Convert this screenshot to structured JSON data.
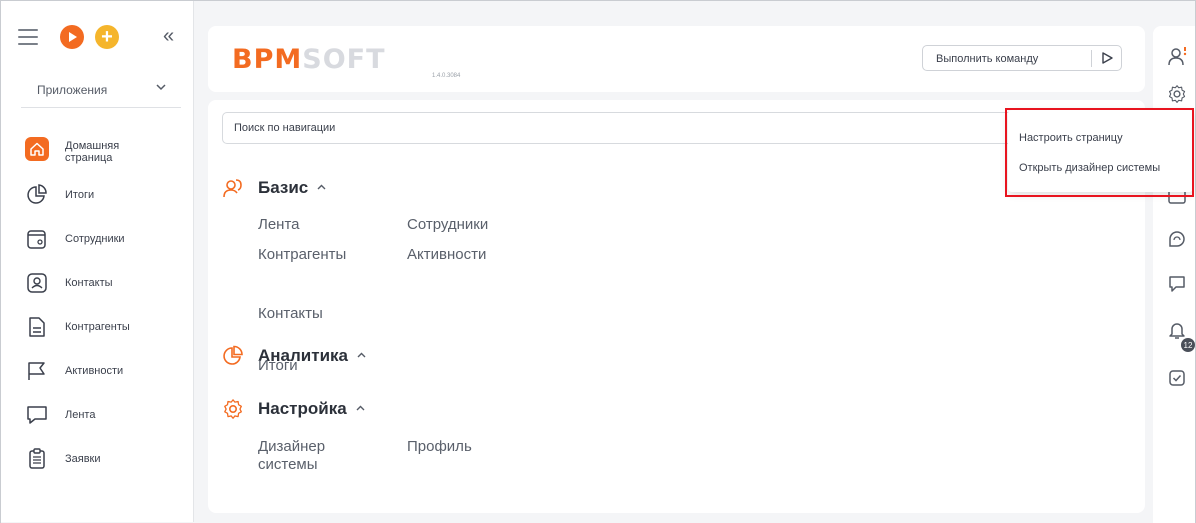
{
  "sidebar": {
    "apps_label": "Приложения",
    "items": [
      {
        "label": "Домашняя\nстраница",
        "icon": "home-icon"
      },
      {
        "label": "Итоги",
        "icon": "pie-chart-icon"
      },
      {
        "label": "Сотрудники",
        "icon": "employees-icon"
      },
      {
        "label": "Контакты",
        "icon": "contacts-icon"
      },
      {
        "label": "Контрагенты",
        "icon": "document-icon"
      },
      {
        "label": "Активности",
        "icon": "flag-icon"
      },
      {
        "label": "Лента",
        "icon": "chat-icon"
      },
      {
        "label": "Заявки",
        "icon": "clipboard-icon"
      }
    ]
  },
  "header": {
    "logo_left": "BPM",
    "logo_right": "SOFT",
    "version": "1.4.0.3084",
    "command_placeholder": "Выполнить команду"
  },
  "main": {
    "search_placeholder": "Поиск по навигации",
    "sections": [
      {
        "title": "Базис",
        "links": [
          "Лента",
          "Сотрудники",
          "Контрагенты",
          "Активности",
          "Контакты"
        ]
      },
      {
        "title": "Аналитика",
        "links": [
          "Итоги"
        ]
      },
      {
        "title": "Настройка",
        "links": [
          "Дизайнер\nсистемы",
          "Профиль"
        ]
      }
    ]
  },
  "rail": {
    "notification_count": "12"
  },
  "popup": {
    "items": [
      "Настроить страницу",
      "Открыть дизайнер системы"
    ]
  },
  "colors": {
    "accent": "#f36b21",
    "accent_yellow": "#f5b52c",
    "highlight": "#e8141f"
  }
}
